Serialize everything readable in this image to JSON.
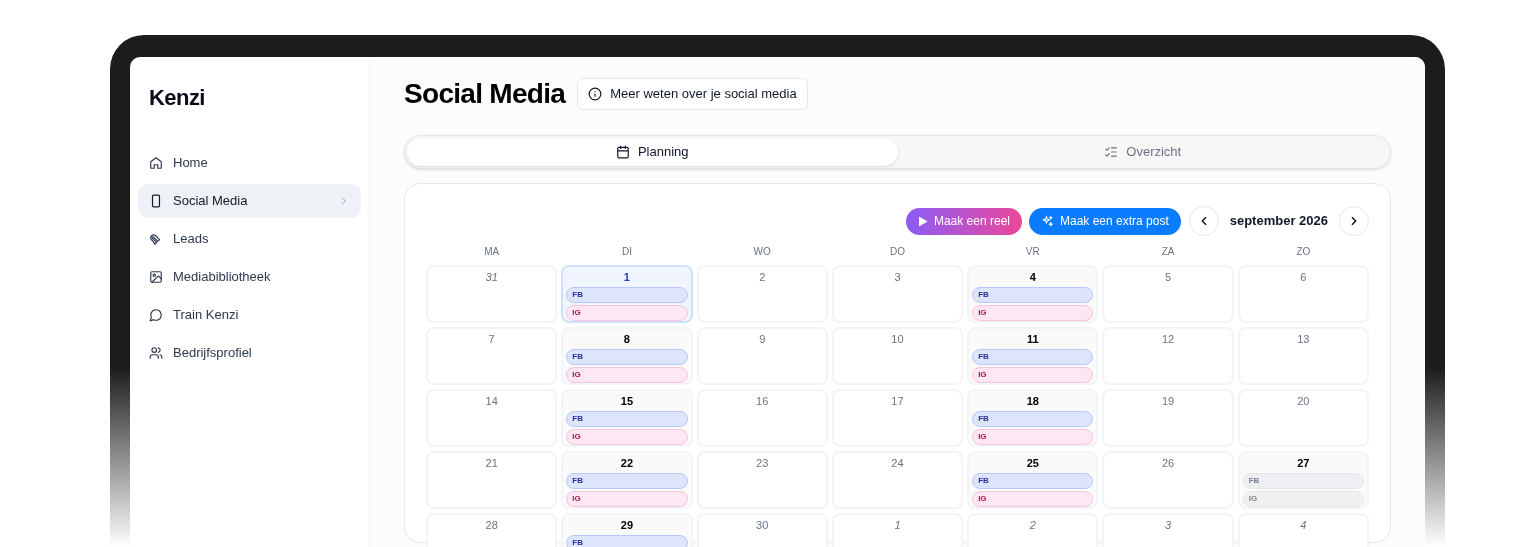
{
  "sidebar": {
    "logo": "Kenzi",
    "items": [
      {
        "label": "Home",
        "selected": false
      },
      {
        "label": "Social Media",
        "selected": true
      },
      {
        "label": "Leads",
        "selected": false
      },
      {
        "label": "Mediabibliotheek",
        "selected": false
      },
      {
        "label": "Train Kenzi",
        "selected": false
      },
      {
        "label": "Bedrijfsprofiel",
        "selected": false
      }
    ]
  },
  "header": {
    "title": "Social Media",
    "info_button": "Meer weten over je social media"
  },
  "tabs": [
    {
      "label": "Planning",
      "selected": true
    },
    {
      "label": "Overzicht",
      "selected": false
    }
  ],
  "calendar": {
    "reel_button": "Maak een reel",
    "post_button": "Maak een extra post",
    "month": "september 2026",
    "weekdays": [
      "MA",
      "DI",
      "WO",
      "DO",
      "VR",
      "ZA",
      "ZO"
    ],
    "weeks": [
      [
        {
          "day": "31",
          "muted": true,
          "today": false
        },
        {
          "day": "1",
          "muted": false,
          "today": true,
          "posts": [
            {
              "label": "FB",
              "kind": "fb",
              "disabled": false
            },
            {
              "label": "IG",
              "kind": "ig",
              "disabled": false
            }
          ]
        },
        {
          "day": "2",
          "muted": false,
          "today": false
        },
        {
          "day": "3",
          "muted": false,
          "today": false
        },
        {
          "day": "4",
          "muted": false,
          "today": false,
          "posts": [
            {
              "label": "FB",
              "kind": "fb",
              "disabled": false
            },
            {
              "label": "IG",
              "kind": "ig",
              "disabled": false
            }
          ]
        },
        {
          "day": "5",
          "muted": false,
          "today": false
        },
        {
          "day": "6",
          "muted": false,
          "today": false
        }
      ],
      [
        {
          "day": "7",
          "muted": false,
          "today": false
        },
        {
          "day": "8",
          "muted": false,
          "today": false,
          "posts": [
            {
              "label": "FB",
              "kind": "fb",
              "disabled": false
            },
            {
              "label": "IG",
              "kind": "ig",
              "disabled": false
            }
          ]
        },
        {
          "day": "9",
          "muted": false,
          "today": false
        },
        {
          "day": "10",
          "muted": false,
          "today": false
        },
        {
          "day": "11",
          "muted": false,
          "today": false,
          "posts": [
            {
              "label": "FB",
              "kind": "fb",
              "disabled": false
            },
            {
              "label": "IG",
              "kind": "ig",
              "disabled": false
            }
          ]
        },
        {
          "day": "12",
          "muted": false,
          "today": false
        },
        {
          "day": "13",
          "muted": false,
          "today": false
        }
      ],
      [
        {
          "day": "14",
          "muted": false,
          "today": false
        },
        {
          "day": "15",
          "muted": false,
          "today": false,
          "posts": [
            {
              "label": "FB",
              "kind": "fb",
              "disabled": false
            },
            {
              "label": "IG",
              "kind": "ig",
              "disabled": false
            }
          ]
        },
        {
          "day": "16",
          "muted": false,
          "today": false
        },
        {
          "day": "17",
          "muted": false,
          "today": false
        },
        {
          "day": "18",
          "muted": false,
          "today": false,
          "posts": [
            {
              "label": "FB",
              "kind": "fb",
              "disabled": false
            },
            {
              "label": "IG",
              "kind": "ig",
              "disabled": false
            }
          ]
        },
        {
          "day": "19",
          "muted": false,
          "today": false
        },
        {
          "day": "20",
          "muted": false,
          "today": false
        }
      ],
      [
        {
          "day": "21",
          "muted": false,
          "today": false
        },
        {
          "day": "22",
          "muted": false,
          "today": false,
          "posts": [
            {
              "label": "FB",
              "kind": "fb",
              "disabled": false
            },
            {
              "label": "IG",
              "kind": "ig",
              "disabled": false
            }
          ]
        },
        {
          "day": "23",
          "muted": false,
          "today": false
        },
        {
          "day": "24",
          "muted": false,
          "today": false
        },
        {
          "day": "25",
          "muted": false,
          "today": false,
          "posts": [
            {
              "label": "FB",
              "kind": "fb",
              "disabled": false
            },
            {
              "label": "IG",
              "kind": "ig",
              "disabled": false
            }
          ]
        },
        {
          "day": "26",
          "muted": false,
          "today": false
        },
        {
          "day": "27",
          "muted": false,
          "today": false,
          "posts": [
            {
              "label": "FB",
              "kind": "fb",
              "disabled": true
            },
            {
              "label": "IG",
              "kind": "ig",
              "disabled": true
            }
          ]
        }
      ],
      [
        {
          "day": "28",
          "muted": false,
          "today": false
        },
        {
          "day": "29",
          "muted": false,
          "today": false,
          "posts": [
            {
              "label": "FB",
              "kind": "fb",
              "disabled": false
            }
          ]
        },
        {
          "day": "30",
          "muted": false,
          "today": false
        },
        {
          "day": "1",
          "muted": true,
          "today": false
        },
        {
          "day": "2",
          "muted": true,
          "today": false
        },
        {
          "day": "3",
          "muted": true,
          "today": false
        },
        {
          "day": "4",
          "muted": true,
          "today": false
        }
      ]
    ]
  }
}
